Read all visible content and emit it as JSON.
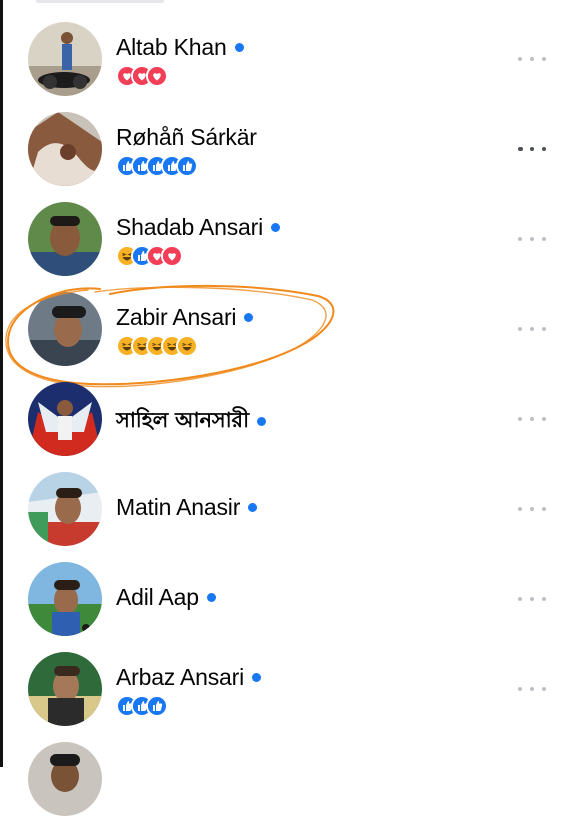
{
  "friends": [
    {
      "name": "Altab Khan",
      "online": true,
      "reactions": [
        "love",
        "love",
        "love"
      ],
      "more_emphasis": false
    },
    {
      "name": "Røhåñ Sárkär",
      "online": false,
      "reactions": [
        "like",
        "like",
        "like",
        "like",
        "like"
      ],
      "more_emphasis": true
    },
    {
      "name": "Shadab Ansari",
      "online": true,
      "reactions": [
        "haha",
        "like",
        "love",
        "love"
      ],
      "more_emphasis": false
    },
    {
      "name": "Zabir Ansari",
      "online": true,
      "reactions": [
        "haha",
        "haha",
        "haha",
        "haha",
        "haha"
      ],
      "more_emphasis": false
    },
    {
      "name": "সাহিল আনসারী",
      "online": true,
      "reactions": [],
      "more_emphasis": false
    },
    {
      "name": "Matin Anasir",
      "online": true,
      "reactions": [],
      "more_emphasis": false
    },
    {
      "name": "Adil Aap",
      "online": true,
      "reactions": [],
      "more_emphasis": false
    },
    {
      "name": "Arbaz Ansari",
      "online": true,
      "reactions": [
        "like",
        "like",
        "like"
      ],
      "more_emphasis": false
    }
  ],
  "colors": {
    "online": "#1877f2",
    "love": "#f33e58",
    "like": "#1877f2",
    "haha": "#f7b125",
    "annotation": "#f08a1c"
  },
  "icons": {
    "more": "more-horizontal-icon",
    "online": "online-dot-icon"
  }
}
